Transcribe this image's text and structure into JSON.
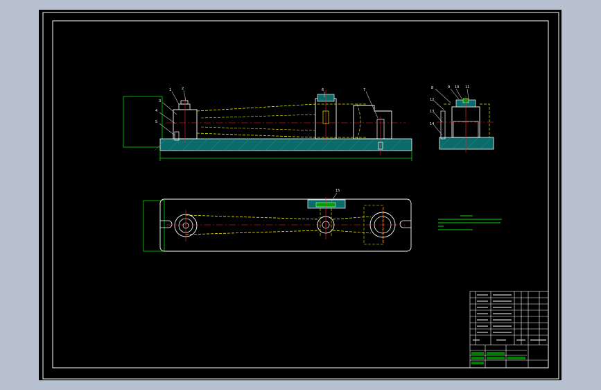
{
  "colors": {
    "background": "#b7c1cf",
    "canvas": "#000000",
    "frame": "#ffffff",
    "part_outline": "#ffffff",
    "hatch": "#00a6a6",
    "centerline": "#ff2020",
    "phantom": "#e8e800",
    "dimension": "#00e000",
    "leader": "#c8c8c8",
    "note_text": "#00e000"
  },
  "drawing": {
    "leader_labels": {
      "front": [
        "1",
        "2",
        "3",
        "4",
        "5",
        "6",
        "7"
      ],
      "side": [
        "8",
        "9",
        "10",
        "11",
        "12",
        "13",
        "14"
      ],
      "top": [
        "15"
      ]
    },
    "dimensions": {
      "overall_length": "",
      "overall_height": "",
      "top_width": ""
    },
    "technical_notes": {
      "title": "",
      "lines": [
        "",
        "",
        "",
        ""
      ]
    }
  },
  "title_block": {
    "rows": 9,
    "cols": 7
  }
}
